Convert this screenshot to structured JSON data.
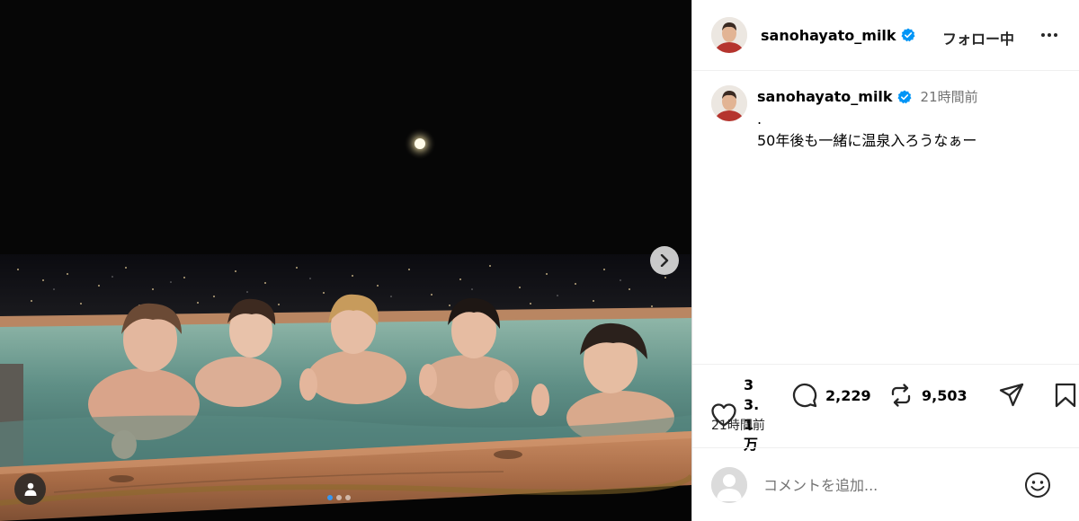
{
  "media": {
    "next_label": "Next",
    "tag_label": "Tagged people",
    "carousel": {
      "count": 3,
      "active_index": 0
    }
  },
  "header": {
    "username": "sanohayato_milk",
    "verified": true,
    "follow_label": "フォロー中",
    "more_label": "More options"
  },
  "caption": {
    "username": "sanohayato_milk",
    "time": "21時間前",
    "text": ".\n50年後も一緒に温泉入ろうなぁー"
  },
  "actions": {
    "likes": "33.1万",
    "comments": "2,229",
    "reposts": "9,503",
    "posted": "21時間前"
  },
  "comment": {
    "placeholder": "コメントを追加..."
  },
  "colors": {
    "verified_blue": "#0095f6",
    "accent_blue": "#3897f0"
  }
}
